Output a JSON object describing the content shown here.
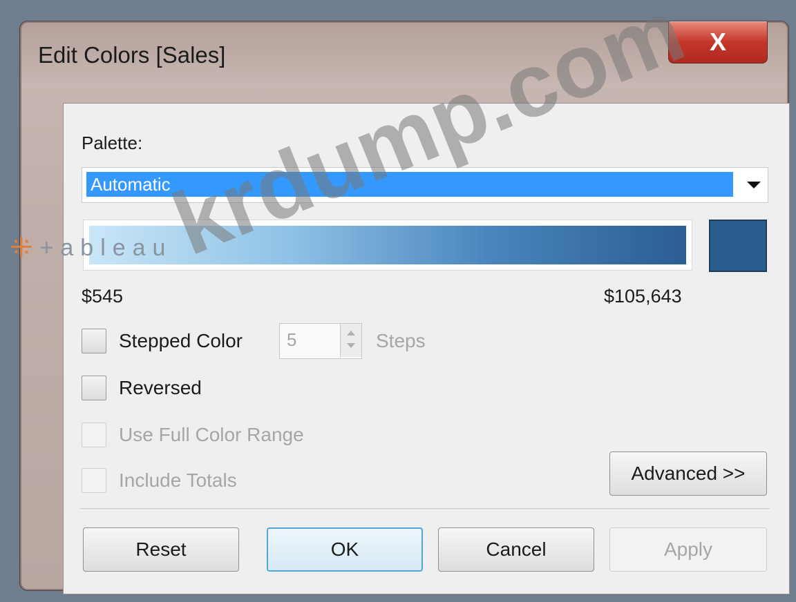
{
  "window": {
    "title": "Edit Colors [Sales]",
    "close_glyph": "X"
  },
  "palette": {
    "label": "Palette:",
    "selected": "Automatic",
    "ramp_colors": [
      "#c9e6f7",
      "#8fc2e6",
      "#4a86bd",
      "#2a5d93"
    ],
    "swatch_color": "#2b5c8f"
  },
  "range": {
    "min": "$545",
    "max": "$105,643"
  },
  "options": {
    "stepped_color": {
      "label": "Stepped Color",
      "checked": false,
      "enabled": true
    },
    "steps_value": "5",
    "steps_label": "Steps",
    "reversed": {
      "label": "Reversed",
      "checked": false,
      "enabled": true
    },
    "use_full_color_range": {
      "label": "Use Full Color Range",
      "checked": false,
      "enabled": false
    },
    "include_totals": {
      "label": "Include Totals",
      "checked": false,
      "enabled": false
    }
  },
  "buttons": {
    "advanced": "Advanced >>",
    "reset": "Reset",
    "ok": "OK",
    "cancel": "Cancel",
    "apply": "Apply"
  },
  "overlay": {
    "logo_text": "+ableau",
    "watermark": "krdump.com"
  }
}
